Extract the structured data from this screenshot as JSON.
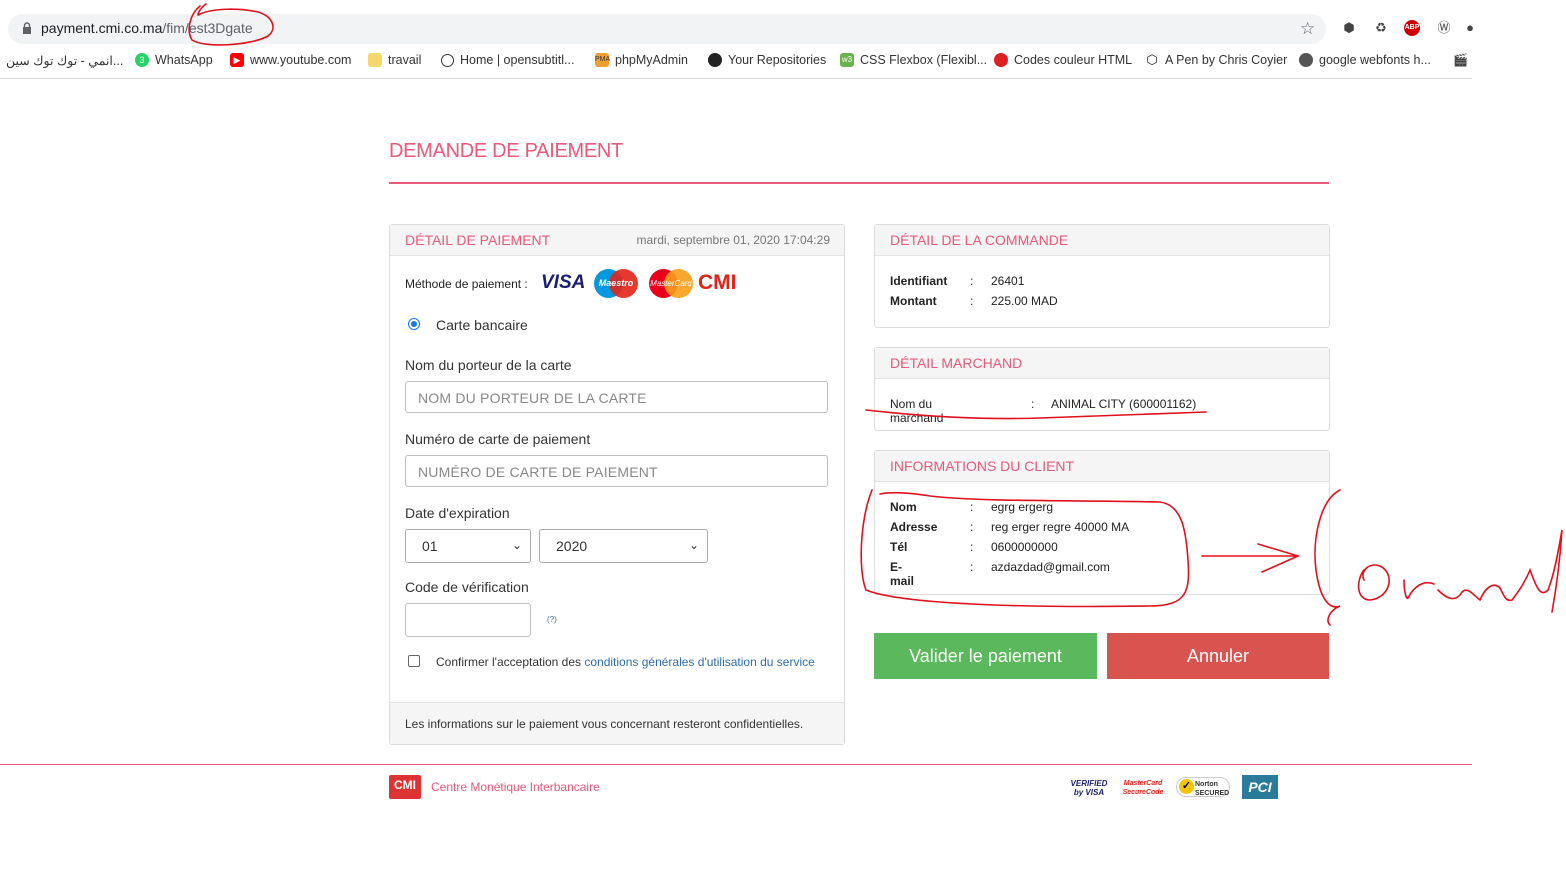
{
  "browser": {
    "url_host": "payment.cmi.co.ma",
    "url_path": "/fim/est3Dgate",
    "bookmarks": [
      {
        "label": "انمي - توك توك سين..."
      },
      {
        "label": "WhatsApp"
      },
      {
        "label": "www.youtube.com"
      },
      {
        "label": "travail"
      },
      {
        "label": "Home | opensubtitl..."
      },
      {
        "label": "phpMyAdmin"
      },
      {
        "label": "Your Repositories"
      },
      {
        "label": "CSS Flexbox (Flexibl..."
      },
      {
        "label": "Codes couleur HTML"
      },
      {
        "label": "A Pen by Chris Coyier"
      },
      {
        "label": "google webfonts h..."
      }
    ]
  },
  "page": {
    "title": "DEMANDE DE PAIEMENT"
  },
  "payment_detail": {
    "heading": "DÉTAIL DE PAIEMENT",
    "date": "mardi, septembre 01, 2020 17:04:29",
    "method_label": "Méthode de paiement :",
    "logos": {
      "visa": "VISA",
      "maestro": "Maestro",
      "mastercard": "MasterCard",
      "cmi": "CMI"
    },
    "radio_label": "Carte bancaire",
    "holder_label": "Nom du porteur de la carte",
    "holder_placeholder": "NOM DU PORTEUR DE LA CARTE",
    "card_label": "Numéro de carte de paiement",
    "card_placeholder": "NUMÉRO DE CARTE DE PAIEMENT",
    "expiry_label": "Date d'expiration",
    "expiry_month": "01",
    "expiry_year": "2020",
    "cvv_label": "Code de vérification",
    "cvv_help": "(?)",
    "terms_prefix": "Confirmer l'acceptation des ",
    "terms_link": "conditions générales d'utilisation du service",
    "footer_note": "Les informations sur le paiement vous concernant resteront confidentielles."
  },
  "order_detail": {
    "heading": "DÉTAIL DE LA COMMANDE",
    "rows": [
      {
        "key": "Identifiant",
        "sep": ":",
        "value": "26401"
      },
      {
        "key": "Montant",
        "sep": ":",
        "value": "225.00 MAD"
      }
    ]
  },
  "merchant_detail": {
    "heading": "DÉTAIL MARCHAND",
    "key": "Nom du marchand",
    "sep": ":",
    "value": "ANIMAL CITY (600001162)"
  },
  "client_info": {
    "heading": "INFORMATIONS DU CLIENT",
    "rows": [
      {
        "key": "Nom",
        "sep": ":",
        "value": "egrg ergerg"
      },
      {
        "key": "Adresse",
        "sep": ":",
        "value": "reg erger regre 40000 MA"
      },
      {
        "key": "Tél",
        "sep": ":",
        "value": "0600000000"
      },
      {
        "key": "E-mail",
        "sep": ":",
        "value": "azdazdad@gmail.com"
      }
    ]
  },
  "actions": {
    "validate": "Valider le paiement",
    "cancel": "Annuler",
    "validate_color": "#5cb85c",
    "cancel_color": "#d9534f"
  },
  "footer": {
    "org": "Centre Monétique Interbancaire",
    "cmi_logo": "CMI",
    "badges": {
      "verified": "VERIFIED by VISA",
      "mastercard": "MasterCard SecureCode",
      "norton": "Norton SECURED",
      "pci": "PCI"
    }
  },
  "colors": {
    "accent": "#e8597a",
    "annotation": "#e0101c"
  }
}
